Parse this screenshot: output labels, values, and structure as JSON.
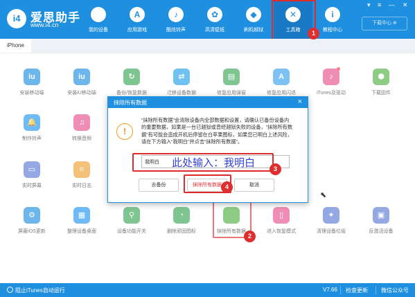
{
  "app": {
    "logo_text": "i4",
    "title": "爱思助手",
    "url": "www.i4.cn",
    "download_center": "下载中心 ⊕"
  },
  "nav": [
    {
      "label": "我的设备",
      "icon": "apple-icon",
      "glyph": ""
    },
    {
      "label": "应用游戏",
      "icon": "app-store-icon",
      "glyph": "A"
    },
    {
      "label": "酷炫铃声",
      "icon": "bell-icon",
      "glyph": "♪"
    },
    {
      "label": "高清壁纸",
      "icon": "flower-icon",
      "glyph": "✿"
    },
    {
      "label": "刷机越狱",
      "icon": "dropbox-icon",
      "glyph": "◆"
    },
    {
      "label": "工具箱",
      "icon": "tools-icon",
      "glyph": "✕"
    },
    {
      "label": "教程中心",
      "icon": "info-icon",
      "glyph": "i"
    }
  ],
  "window_controls": [
    "▾",
    "≡",
    "—",
    "✕"
  ],
  "tab": "iPhone",
  "tiles_row1": [
    {
      "label": "安装移动端",
      "glyph": "iu",
      "color": "#1f8fe0"
    },
    {
      "label": "安装iU移动端",
      "glyph": "iu",
      "color": "#1f8fe0"
    },
    {
      "label": "备份/恢复数据",
      "glyph": "↻",
      "color": "#3aa757"
    },
    {
      "label": "迁移设备数据",
      "glyph": "⇄",
      "color": "#21a0e8"
    },
    {
      "label": "修复应用弹窗",
      "glyph": "▤",
      "color": "#3aa757"
    },
    {
      "label": "修复应用闪退",
      "glyph": "A",
      "color": "#3aa2ee"
    },
    {
      "label": "iTunes及驱动",
      "glyph": "♪",
      "color": "#e6508c"
    },
    {
      "label": "下载固件",
      "glyph": "⬢",
      "color": "#52b043"
    }
  ],
  "tiles_row2": [
    {
      "label": "制作铃声",
      "glyph": "🔔",
      "color": "#2196f3"
    },
    {
      "label": "转换音频",
      "glyph": "♫",
      "color": "#e6508c"
    }
  ],
  "tiles_row3": [
    {
      "label": "实时屏幕",
      "glyph": "▭",
      "color": "#5b7bd6"
    },
    {
      "label": "实时日志",
      "glyph": "≡",
      "color": "#f0a030"
    }
  ],
  "tiles_row4": [
    {
      "label": "屏蔽iOS更新",
      "glyph": "⚙",
      "color": "#1f8fe0"
    },
    {
      "label": "整理设备桌面",
      "glyph": "▦",
      "color": "#2196f3"
    },
    {
      "label": "设备功能开关",
      "glyph": "⚲",
      "color": "#3aa757"
    },
    {
      "label": "删除顽固图标",
      "glyph": "◔",
      "color": "#3aa757"
    },
    {
      "label": "抹除所有数据",
      "glyph": "",
      "color": "#52b043"
    },
    {
      "label": "进入恢复模式",
      "glyph": "▯",
      "color": "#e6508c"
    },
    {
      "label": "清理设备垃圾",
      "glyph": "✦",
      "color": "#5b7bd6"
    },
    {
      "label": "反激活设备",
      "glyph": "▣",
      "color": "#5b7bd6"
    }
  ],
  "modal": {
    "title": "抹除所有数据",
    "close": "×",
    "warning_glyph": "!",
    "text": "“抹除所有数据”会清除设备内全部数据和设置，请确认已备份设备内的重要数据，如果是一台已越狱或曾经越狱失败的设备，“抹除所有数据”有可能会造成开机后停留在白苹果图标，如果您已明白上述风险，请在下方输入“我明白”并点击“抹除所有数据”。",
    "input_value": "我明白",
    "annotation": "此处输入：我明白",
    "btn_backup": "去备份",
    "btn_erase": "抹除所有数据",
    "btn_cancel": "取消"
  },
  "badges": [
    "1",
    "2",
    "3",
    "4"
  ],
  "status": {
    "itunes_toggle": "阻止iTunes自动运行",
    "version": "V7.66",
    "check_update": "检查更新",
    "wechat": "微信公众号"
  },
  "colors": {
    "primary": "#1f8fe0",
    "annotation_red": "#e02a2a",
    "annotation_blue": "#2f3fd8"
  }
}
